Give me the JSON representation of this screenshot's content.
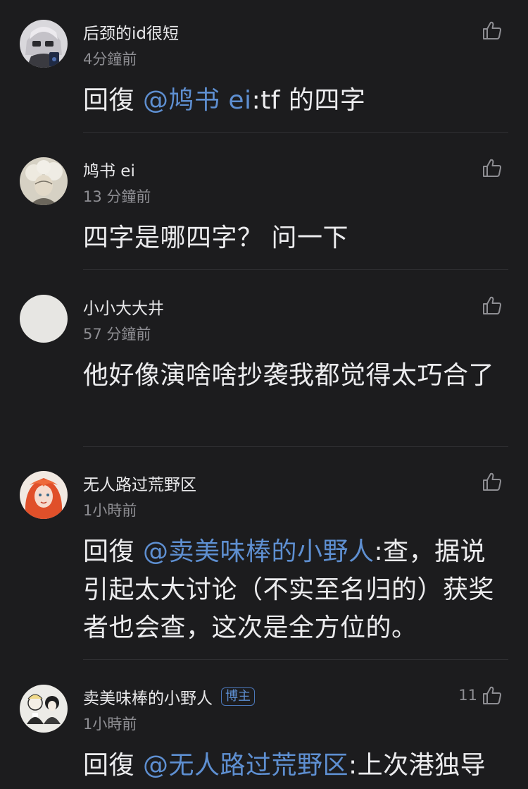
{
  "comments": [
    {
      "username": "后颈的id很短",
      "time": "4分鐘前",
      "reply_prefix": "回復 ",
      "mention": "@鸠书 ei",
      "text": ":tf 的四字",
      "like_count": ""
    },
    {
      "username": "鸠书 ei",
      "time": "13 分鐘前",
      "text": "四字是哪四字？ 问一下",
      "like_count": ""
    },
    {
      "username": "小小大大井",
      "time": "57 分鐘前",
      "text": "他好像演啥啥抄袭我都觉得太巧合了",
      "like_count": ""
    },
    {
      "username": "无人路过荒野区",
      "time": "1小時前",
      "reply_prefix": "回復 ",
      "mention": "@卖美味棒的小野人",
      "text": ":查，据说引起太大讨论（不实至名归的）获奖者也会查，这次是全方位的。",
      "like_count": ""
    },
    {
      "username": "卖美味棒的小野人",
      "badge": "博主",
      "time": "1小時前",
      "reply_prefix": "回復 ",
      "mention": "@无人路过荒野区",
      "text": ":上次港独导",
      "like_count": "11"
    }
  ],
  "icons": {
    "like": "thumbs-up-outline-icon"
  },
  "colors": {
    "background": "#1c1c1e",
    "mention": "#5e8fd1",
    "secondary_text": "#8e8e93"
  }
}
